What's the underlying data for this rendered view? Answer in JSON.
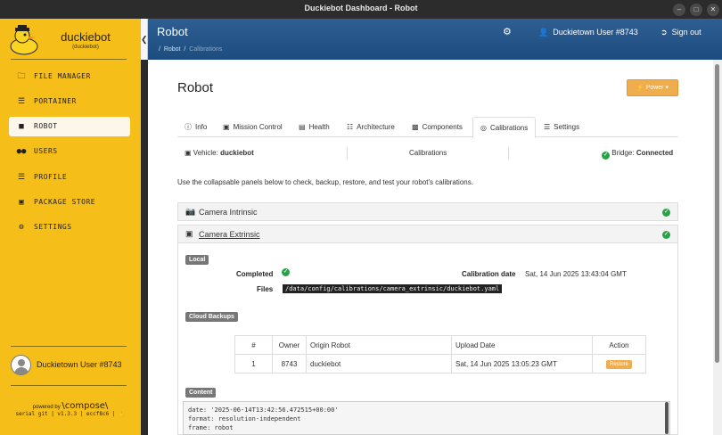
{
  "window": {
    "title": "Duckiebot Dashboard - Robot"
  },
  "sidebar": {
    "brand_name": "duckiebot",
    "brand_sub": "(duckiebot)",
    "items": [
      {
        "icon": "folder-icon",
        "label": "FILE MANAGER"
      },
      {
        "icon": "sliders-icon",
        "label": "PORTAINER"
      },
      {
        "icon": "android-icon",
        "label": "ROBOT"
      },
      {
        "icon": "users-icon",
        "label": "USERS"
      },
      {
        "icon": "list-icon",
        "label": "PROFILE"
      },
      {
        "icon": "shopping-bag-icon",
        "label": "PACKAGE STORE"
      },
      {
        "icon": "gear-icon",
        "label": "SETTINGS"
      }
    ],
    "user_name": "Duckietown User #8743",
    "powered_by": "powered by",
    "compose_logo": "\\compose\\",
    "version": "serial git | v1.3.3 | eccf8c6 | ✋"
  },
  "header": {
    "title": "Robot",
    "breadcrumb": {
      "sep": "/",
      "root": "Robot",
      "current": "Calibrations"
    },
    "user": "Duckietown User #8743",
    "signout": "Sign out"
  },
  "page": {
    "title": "Robot",
    "power_button": "Power",
    "tabs": [
      {
        "icon": "info-icon",
        "label": "Info"
      },
      {
        "icon": "car-icon",
        "label": "Mission Control"
      },
      {
        "icon": "medkit-icon",
        "label": "Health"
      },
      {
        "icon": "sitemap-icon",
        "label": "Architecture"
      },
      {
        "icon": "puzzle-icon",
        "label": "Components"
      },
      {
        "icon": "target-icon",
        "label": "Calibrations"
      },
      {
        "icon": "sliders-icon",
        "label": "Settings"
      }
    ],
    "vehicle_label": "Vehicle:",
    "vehicle_value": "duckiebot",
    "center_label": "Calibrations",
    "bridge_label": "Bridge:",
    "bridge_value": "Connected",
    "description": "Use the collapsable panels below to check, backup, restore, and test your robot's calibrations."
  },
  "panels": {
    "intrinsic": {
      "title": "Camera Intrinsic"
    },
    "extrinsic": {
      "title": "Camera Extrinsic",
      "local_badge": "Local",
      "completed_label": "Completed",
      "calib_date_label": "Calibration date",
      "calib_date_value": "Sat, 14 Jun 2025 13:43:04 GMT",
      "files_label": "Files",
      "file_path": "/data/config/calibrations/camera_extrinsic/duckiebot.yaml",
      "cloud_badge": "Cloud Backups",
      "table": {
        "headers": [
          "#",
          "Owner",
          "Origin Robot",
          "Upload Date",
          "Action"
        ],
        "rows": [
          {
            "num": "1",
            "owner": "8743",
            "origin": "duckiebot",
            "date": "Sat, 14 Jun 2025 13:05:23 GMT",
            "action": "Restore"
          }
        ]
      },
      "content_badge": "Content",
      "content_lines": [
        "date: '2025-06-14T13:42:56.472515+00:00'",
        "format: resolution-independent",
        "frame: robot"
      ]
    }
  },
  "colors": {
    "sidebar": "#f6be18",
    "header": "#1d4d80",
    "accent": "#f0ad4e",
    "success": "#27a345"
  }
}
